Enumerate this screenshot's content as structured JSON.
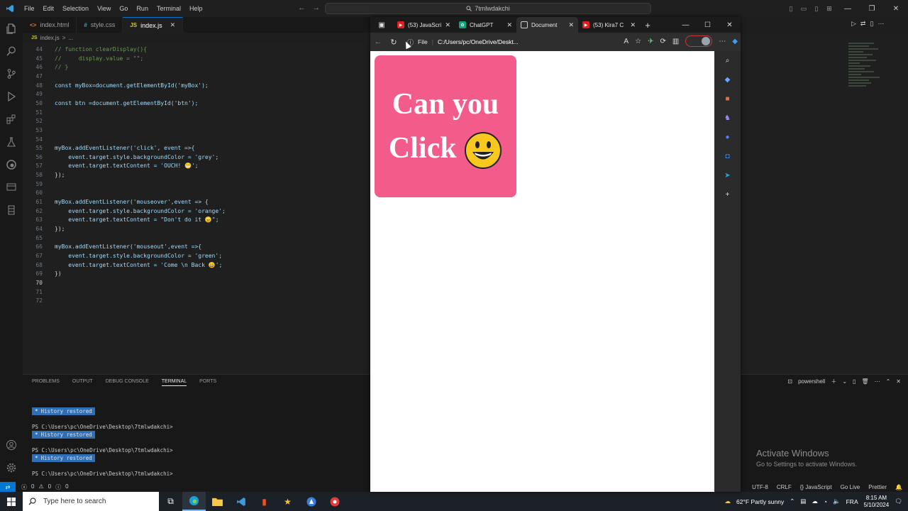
{
  "vscode": {
    "menu": [
      "File",
      "Edit",
      "Selection",
      "View",
      "Go",
      "Run",
      "Terminal",
      "Help"
    ],
    "search": "7tmlwdakchi",
    "editor_tabs": [
      {
        "icon": "<>",
        "label": "index.html"
      },
      {
        "icon": "#",
        "label": "style.css"
      },
      {
        "icon": "JS",
        "label": "index.js"
      }
    ],
    "breadcrumb": [
      "index.js",
      ">",
      "..."
    ],
    "code_lines": [
      {
        "n": "44",
        "text": "// function clearDisplay(){"
      },
      {
        "n": "45",
        "text": "//     display.value = \"\";"
      },
      {
        "n": "46",
        "text": "// }"
      },
      {
        "n": "47",
        "text": ""
      },
      {
        "n": "48",
        "text": "const myBox=document.getElementById('myBox');"
      },
      {
        "n": "49",
        "text": ""
      },
      {
        "n": "50",
        "text": "const btn =document.getElementById('btn');"
      },
      {
        "n": "51",
        "text": ""
      },
      {
        "n": "52",
        "text": ""
      },
      {
        "n": "53",
        "text": ""
      },
      {
        "n": "54",
        "text": ""
      },
      {
        "n": "55",
        "text": "myBox.addEventListener('click', event =>{"
      },
      {
        "n": "56",
        "text": "    event.target.style.backgroundColor = 'grey';"
      },
      {
        "n": "57",
        "text": "    event.target.textContent = 'OUCH! 😬';"
      },
      {
        "n": "58",
        "text": "});"
      },
      {
        "n": "59",
        "text": ""
      },
      {
        "n": "60",
        "text": ""
      },
      {
        "n": "61",
        "text": "myBox.addEventListener('mouseover',event => {"
      },
      {
        "n": "62",
        "text": "    event.target.style.backgroundColor = 'orange';"
      },
      {
        "n": "63",
        "text": "    event.target.textContent = \"Don't do it 😠\";"
      },
      {
        "n": "64",
        "text": "});"
      },
      {
        "n": "65",
        "text": ""
      },
      {
        "n": "66",
        "text": "myBox.addEventListener('mouseout',event =>{"
      },
      {
        "n": "67",
        "text": "    event.target.style.backgroundColor = 'green';"
      },
      {
        "n": "68",
        "text": "    event.target.textContent = 'Come \\n Back 😀';"
      },
      {
        "n": "69",
        "text": "})"
      },
      {
        "n": "70",
        "text": ""
      },
      {
        "n": "71",
        "text": ""
      },
      {
        "n": "72",
        "text": ""
      }
    ],
    "current_line": "70",
    "panel": {
      "tabs": [
        "PROBLEMS",
        "OUTPUT",
        "DEBUG CONSOLE",
        "TERMINAL",
        "PORTS"
      ],
      "active_tab": "TERMINAL",
      "shell": "powershell",
      "history_label": "History restored",
      "prompt": "PS C:\\Users\\pc\\OneDrive\\Desktop\\7tmlwdakchi>"
    },
    "watermark": {
      "title": "Activate Windows",
      "sub": "Go to Settings to activate Windows."
    },
    "status": {
      "errors": "0",
      "warnings": "0",
      "info": "0",
      "right": [
        "UTF-8",
        "CRLF",
        "{} JavaScript",
        "Go Live",
        "Prettier"
      ]
    }
  },
  "browser": {
    "tabs": [
      {
        "label": "(53) JavaScri",
        "color": "#e02020",
        "active": false
      },
      {
        "label": "ChatGPT",
        "color": "#10a37f",
        "active": false
      },
      {
        "label": "Document",
        "color": "#555555",
        "active": true
      },
      {
        "label": "(53) Kira7 C",
        "color": "#e02020",
        "active": false
      }
    ],
    "address_scheme": "File",
    "address_url": "C:/Users/pc/OneDrive/Deskt...",
    "box": {
      "line1": "Can you",
      "line2": "Click",
      "color": "#f35b8b"
    }
  },
  "taskbar": {
    "search_placeholder": "Type here to search",
    "weather": "62°F  Partly sunny",
    "lang": "FRA",
    "time": "8:15 AM",
    "date": "5/10/2024"
  }
}
